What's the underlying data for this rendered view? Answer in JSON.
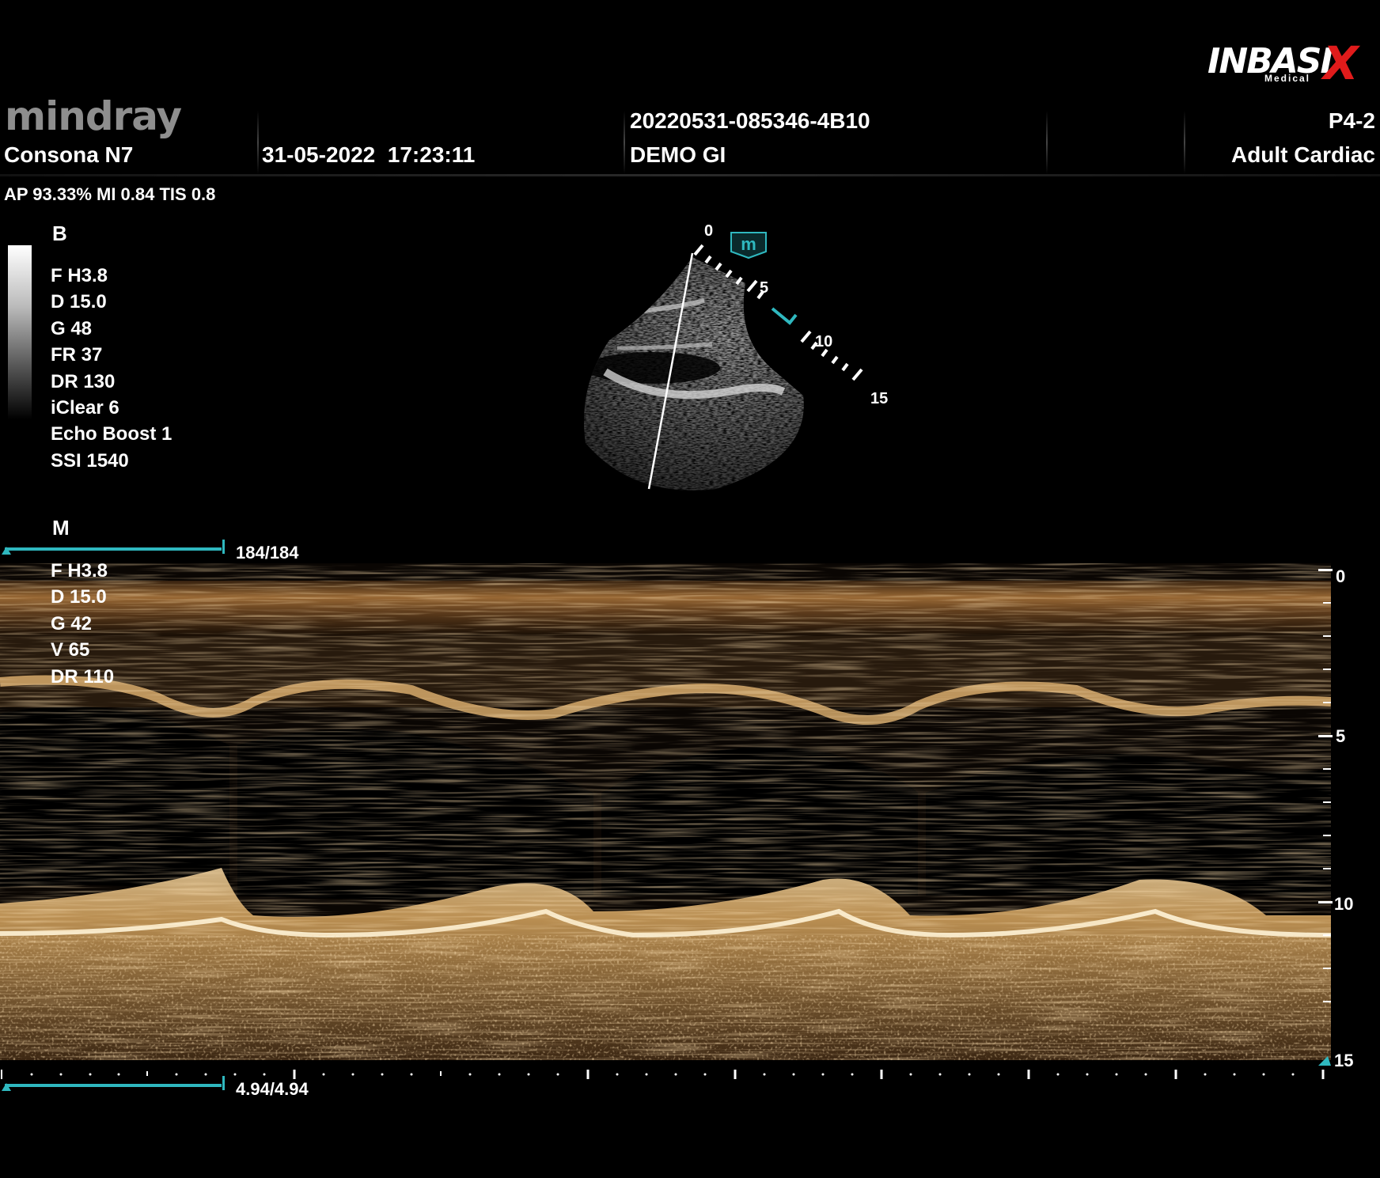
{
  "header": {
    "brand_logo": "mindray",
    "model": "Consona N7",
    "datetime": "31-05-2022  17:23:11",
    "study_id": "20220531-085346-4B10",
    "preset_name": "DEMO GI",
    "probe": "P4-2",
    "exam_type": "Adult Cardiac",
    "vendor_logo": "INBASI",
    "vendor_logo_x": "X",
    "vendor_logo_sub": "Medical"
  },
  "acoustic": {
    "text": "AP 93.33%  MI 0.84 TIS 0.8"
  },
  "b_mode": {
    "label": "B",
    "params": [
      "F H3.8",
      "D 15.0",
      "G 48",
      "FR 37",
      "DR 130",
      "iClear 6",
      "Echo Boost 1",
      "SSI 1540"
    ],
    "depth_labels": [
      "0",
      "5",
      "10",
      "15"
    ],
    "mmode_marker": "m"
  },
  "m_mode": {
    "label": "M",
    "cine_frames": "184/184",
    "params": [
      "F H3.8",
      "D 15.0",
      "G 42",
      "V 65",
      "DR 110"
    ],
    "depth_labels": [
      "0",
      "5",
      "10",
      "15"
    ],
    "time_readout": "4.94/4.94"
  },
  "colors": {
    "accent": "#2fb8bf",
    "m_tint": "#e0a860"
  }
}
